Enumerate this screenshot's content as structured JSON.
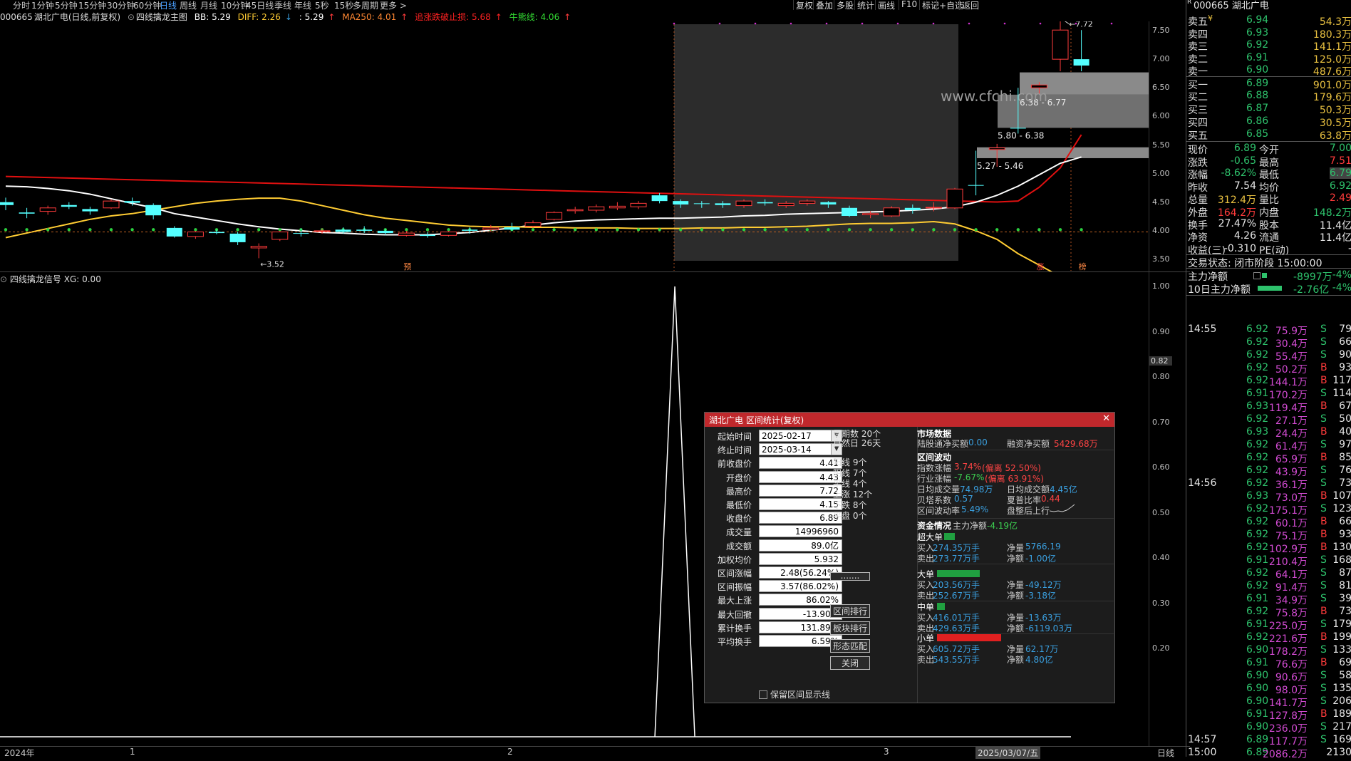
{
  "toolbar": {
    "periods": [
      "分时",
      "1分钟",
      "5分钟",
      "15分钟",
      "30分钟",
      "60分钟",
      "日线",
      "周线",
      "月线",
      "10分钟",
      "45日线",
      "季线",
      "年线",
      "5秒",
      "15秒",
      "多周期",
      "更多 >"
    ],
    "tools": [
      "复权",
      "叠加",
      "多股",
      "统计",
      "画线",
      "F10",
      "标记",
      "+自选",
      "返回"
    ]
  },
  "main_chart": {
    "code": "000665",
    "name": "湖北广电",
    "period_desc": "(日线,前复权)",
    "indicator_name": "四线擒龙主图",
    "bb": "BB: 5.29",
    "diff": "DIFF: 2.26",
    "diff_arrow": "↓",
    "third": ": 5.29",
    "third_arrow": "↑",
    "ma250": "MA250: 4.01",
    "ma250_arrow": "↑",
    "zhisun": "追涨跌破止损: 5.68",
    "zhisun_arrow": "↑",
    "niuhui": "牛熊线: 4.06",
    "niuhui_arrow": "↑",
    "y_ticks": [
      "7.50",
      "7.00",
      "6.50",
      "6.00",
      "5.50",
      "5.00",
      "4.50",
      "4.00",
      "3.50"
    ],
    "high_label": "7.72",
    "low_label": "3.52",
    "watermark": "www.cfchi.com",
    "ranges": [
      "6.38 - 6.77",
      "5.80 - 6.38",
      "5.27 - 5.46"
    ],
    "mark_yu": "预",
    "mark_zhang": "涨",
    "mark_bang": "榜"
  },
  "sub_chart": {
    "title": "四线擒龙信号",
    "xg": "XG: 0.00",
    "y_ticks": [
      "1.00",
      "0.90",
      "0.80",
      "0.70",
      "0.60",
      "0.50",
      "0.40",
      "0.30",
      "0.20"
    ],
    "cursor_value": "0.82",
    "x_labels": [
      "2024年",
      "1",
      "2",
      "3"
    ],
    "cursor_date": "2025/03/07/五",
    "period_label": "日线",
    "spike_x": 0.5875,
    "spike_value": 1.0
  },
  "dialog": {
    "title": "湖北广电 区间统计(复权)",
    "close": "✕",
    "fields": [
      {
        "label": "起始时间",
        "value": "2025-02-17",
        "dropdown": true
      },
      {
        "label": "终止时间",
        "value": "2025-03-14",
        "dropdown": true
      },
      {
        "label": "前收盘价",
        "value": "4.41"
      },
      {
        "label": "开盘价",
        "value": "4.43"
      },
      {
        "label": "最高价",
        "value": "7.72"
      },
      {
        "label": "最低价",
        "value": "4.15"
      },
      {
        "label": "收盘价",
        "value": "6.89"
      },
      {
        "label": "成交量",
        "value": "14996960"
      },
      {
        "label": "成交额",
        "value": "89.0亿"
      },
      {
        "label": "加权均价",
        "value": "5.932"
      },
      {
        "label": "区间涨幅",
        "value": "2.48(56.24%)"
      },
      {
        "label": "区间振幅",
        "value": "3.57(86.02%)"
      },
      {
        "label": "最大上涨",
        "value": "86.02%"
      },
      {
        "label": "最大回撤",
        "value": "-13.90%"
      },
      {
        "label": "累计换手",
        "value": "131.89%"
      },
      {
        "label": "平均换手",
        "value": "6.59%"
      }
    ],
    "checkbox_label": "保留区间显示线",
    "counts": [
      {
        "label": "周期数",
        "value": "20个"
      },
      {
        "label": "自然日",
        "value": "26天"
      },
      {
        "label": "阳线",
        "value": "9个"
      },
      {
        "label": "阴线",
        "value": "7个"
      },
      {
        "label": "平线",
        "value": "4个"
      },
      {
        "label": "上涨",
        "value": "12个"
      },
      {
        "label": "下跌",
        "value": "8个"
      },
      {
        "label": "平盘",
        "value": "0个"
      }
    ],
    "buttons": [
      ".......",
      "区间排行",
      "板块排行",
      "形态匹配",
      "关闭"
    ],
    "market_title": "市场数据",
    "lugu_label": "陆股通净买额",
    "lugu_value": "0.00",
    "rongzi_label": "融资净买额",
    "rongzi_value": "5429.68万",
    "wave_title": "区间波动",
    "zhishu_label": "指数涨幅",
    "zhishu_value": "3.74%",
    "zhishu_dev": "(偏离 52.50%)",
    "hangye_label": "行业涨幅",
    "hangye_value": "-7.67%",
    "hangye_dev": "(偏离 63.91%)",
    "avgvol_label": "日均成交量",
    "avgvol_value": "74.98万",
    "avgamt_label": "日均成交额",
    "avgamt_value": "4.45亿",
    "beta_label": "贝塔系数",
    "beta_value": "0.57",
    "sharpe_label": "夏普比率",
    "sharpe_value": "0.44",
    "vol_label": "区间波动率",
    "vol_value": "5.49%",
    "trend_label": "盘整后上行",
    "fund_title": "资金情况",
    "main_net_label": "主力净额",
    "main_net_value": "-4.19亿",
    "flows": [
      {
        "name": "超大单",
        "buy": "274.35万手",
        "sell": "273.77万手",
        "net": "5766.19",
        "net_amt": "-1.00亿",
        "bar_color": "#20a040",
        "bar_frac": 0.1
      },
      {
        "name": "大单",
        "buy": "203.56万手",
        "sell": "252.67万手",
        "net": "-49.12万",
        "net_amt": "-3.18亿",
        "bar_color": "#20a040",
        "bar_frac": 0.4
      },
      {
        "name": "中单",
        "buy": "416.01万手",
        "sell": "429.63万手",
        "net": "-13.63万",
        "net_amt": "-6119.03万",
        "bar_color": "#20a040",
        "bar_frac": 0.07
      },
      {
        "name": "小单",
        "buy": "605.72万手",
        "sell": "543.55万手",
        "net": "62.17万",
        "net_amt": "4.80亿",
        "bar_color": "#e02020",
        "bar_frac": 0.6
      }
    ],
    "buy_label": "买入",
    "sell_label": "卖出",
    "net_label": "净量",
    "net_amt_label": "净额"
  },
  "right_panel": {
    "code": "000665",
    "name": "湖北广电",
    "sells": [
      {
        "label": "卖五",
        "price": "6.94",
        "vol": "54.3万"
      },
      {
        "label": "卖四",
        "price": "6.93",
        "vol": "180.3万"
      },
      {
        "label": "卖三",
        "price": "6.92",
        "vol": "141.1万"
      },
      {
        "label": "卖二",
        "price": "6.91",
        "vol": "125.0万"
      },
      {
        "label": "卖一",
        "price": "6.90",
        "vol": "487.6万"
      }
    ],
    "sell5_extra": "¥",
    "buys": [
      {
        "label": "买一",
        "price": "6.89",
        "vol": "901.0万"
      },
      {
        "label": "买二",
        "price": "6.88",
        "vol": "179.6万"
      },
      {
        "label": "买三",
        "price": "6.87",
        "vol": "50.3万"
      },
      {
        "label": "买四",
        "price": "6.86",
        "vol": "30.5万"
      },
      {
        "label": "买五",
        "price": "6.85",
        "vol": "63.8万"
      }
    ],
    "quote": [
      {
        "l1": "现价",
        "v1": "6.89",
        "l2": "今开",
        "v2": "7.00",
        "c1": "green",
        "c2": "green"
      },
      {
        "l1": "涨跌",
        "v1": "-0.65",
        "l2": "最高",
        "v2": "7.51",
        "c1": "green",
        "c2": "red"
      },
      {
        "l1": "涨幅",
        "v1": "-8.62%",
        "l2": "最低",
        "v2": "6.79",
        "c1": "green",
        "c2": "green"
      },
      {
        "l1": "昨收",
        "v1": "7.54",
        "l2": "均价",
        "v2": "6.92",
        "c1": "white",
        "c2": "green"
      },
      {
        "l1": "总量",
        "v1": "312.4万",
        "l2": "量比",
        "v2": "2.49",
        "c1": "yellow",
        "c2": "red"
      },
      {
        "l1": "外盘",
        "v1": "164.2万",
        "l2": "内盘",
        "v2": "148.2万",
        "c1": "red",
        "c2": "green"
      },
      {
        "l1": "换手",
        "v1": "27.47%",
        "l2": "股本",
        "v2": "11.4亿",
        "c1": "white",
        "c2": "white"
      },
      {
        "l1": "净资",
        "v1": "4.26",
        "l2": "流通",
        "v2": "11.4亿",
        "c1": "white",
        "c2": "white"
      },
      {
        "l1": "收益(三)",
        "v1": "-0.310",
        "l2": "PE(动)",
        "v2": "-",
        "c1": "white",
        "c2": "white"
      }
    ],
    "trade_status_label": "交易状态:",
    "trade_status": "闭市阶段",
    "trade_time": "15:00:00",
    "main_net_label": "主力净额",
    "main_net_value": "-8997万",
    "main_net_pct": "-4%",
    "main_net10_label": "10日主力净额",
    "main_net10_value": "-2.76亿",
    "main_net10_pct": "-4%",
    "ticks": [
      {
        "t": "14:55",
        "p": "6.92",
        "v": "75.9万",
        "s": "S",
        "n": "79"
      },
      {
        "t": "",
        "p": "6.92",
        "v": "30.4万",
        "s": "S",
        "n": "66"
      },
      {
        "t": "",
        "p": "6.92",
        "v": "55.4万",
        "s": "S",
        "n": "90"
      },
      {
        "t": "",
        "p": "6.92",
        "v": "50.2万",
        "s": "B",
        "n": "93"
      },
      {
        "t": "",
        "p": "6.92",
        "v": "144.1万",
        "s": "B",
        "n": "117"
      },
      {
        "t": "",
        "p": "6.91",
        "v": "170.2万",
        "s": "S",
        "n": "114"
      },
      {
        "t": "",
        "p": "6.93",
        "v": "119.4万",
        "s": "B",
        "n": "67"
      },
      {
        "t": "",
        "p": "6.92",
        "v": "27.1万",
        "s": "S",
        "n": "50"
      },
      {
        "t": "",
        "p": "6.93",
        "v": "24.4万",
        "s": "B",
        "n": "40"
      },
      {
        "t": "",
        "p": "6.92",
        "v": "61.4万",
        "s": "S",
        "n": "97"
      },
      {
        "t": "",
        "p": "6.92",
        "v": "65.9万",
        "s": "B",
        "n": "85"
      },
      {
        "t": "",
        "p": "6.92",
        "v": "43.9万",
        "s": "S",
        "n": "76"
      },
      {
        "t": "14:56",
        "p": "6.92",
        "v": "36.1万",
        "s": "S",
        "n": "73"
      },
      {
        "t": "",
        "p": "6.93",
        "v": "73.0万",
        "s": "B",
        "n": "107"
      },
      {
        "t": "",
        "p": "6.92",
        "v": "175.1万",
        "s": "S",
        "n": "123"
      },
      {
        "t": "",
        "p": "6.92",
        "v": "60.1万",
        "s": "B",
        "n": "66"
      },
      {
        "t": "",
        "p": "6.92",
        "v": "75.1万",
        "s": "B",
        "n": "93"
      },
      {
        "t": "",
        "p": "6.92",
        "v": "102.9万",
        "s": "B",
        "n": "130"
      },
      {
        "t": "",
        "p": "6.91",
        "v": "210.4万",
        "s": "S",
        "n": "168"
      },
      {
        "t": "",
        "p": "6.92",
        "v": "64.1万",
        "s": "S",
        "n": "87"
      },
      {
        "t": "",
        "p": "6.92",
        "v": "91.4万",
        "s": "S",
        "n": "81"
      },
      {
        "t": "",
        "p": "6.91",
        "v": "34.9万",
        "s": "S",
        "n": "39"
      },
      {
        "t": "",
        "p": "6.92",
        "v": "75.8万",
        "s": "B",
        "n": "73"
      },
      {
        "t": "",
        "p": "6.91",
        "v": "225.0万",
        "s": "S",
        "n": "179"
      },
      {
        "t": "",
        "p": "6.92",
        "v": "221.6万",
        "s": "B",
        "n": "199"
      },
      {
        "t": "",
        "p": "6.90",
        "v": "178.2万",
        "s": "S",
        "n": "133"
      },
      {
        "t": "",
        "p": "6.91",
        "v": "76.6万",
        "s": "B",
        "n": "69"
      },
      {
        "t": "",
        "p": "6.90",
        "v": "90.6万",
        "s": "S",
        "n": "58"
      },
      {
        "t": "",
        "p": "6.90",
        "v": "98.0万",
        "s": "S",
        "n": "135"
      },
      {
        "t": "",
        "p": "6.90",
        "v": "141.7万",
        "s": "S",
        "n": "206"
      },
      {
        "t": "",
        "p": "6.91",
        "v": "127.8万",
        "s": "B",
        "n": "189"
      },
      {
        "t": "",
        "p": "6.90",
        "v": "236.0万",
        "s": "S",
        "n": "217"
      },
      {
        "t": "14:57",
        "p": "6.89",
        "v": "117.7万",
        "s": "S",
        "n": "169"
      },
      {
        "t": "15:00",
        "p": "6.89",
        "v": "2086.2万",
        "s": "",
        "n": "2130"
      }
    ]
  },
  "colors": {
    "up": "#ff3b3b",
    "down": "#2ec26c",
    "cyan_candle": "#54ffff",
    "red_candle": "#ff3b3b",
    "ma_white": "#ffffff",
    "ma_yellow": "#ffcc33",
    "ma_red": "#e01010"
  }
}
